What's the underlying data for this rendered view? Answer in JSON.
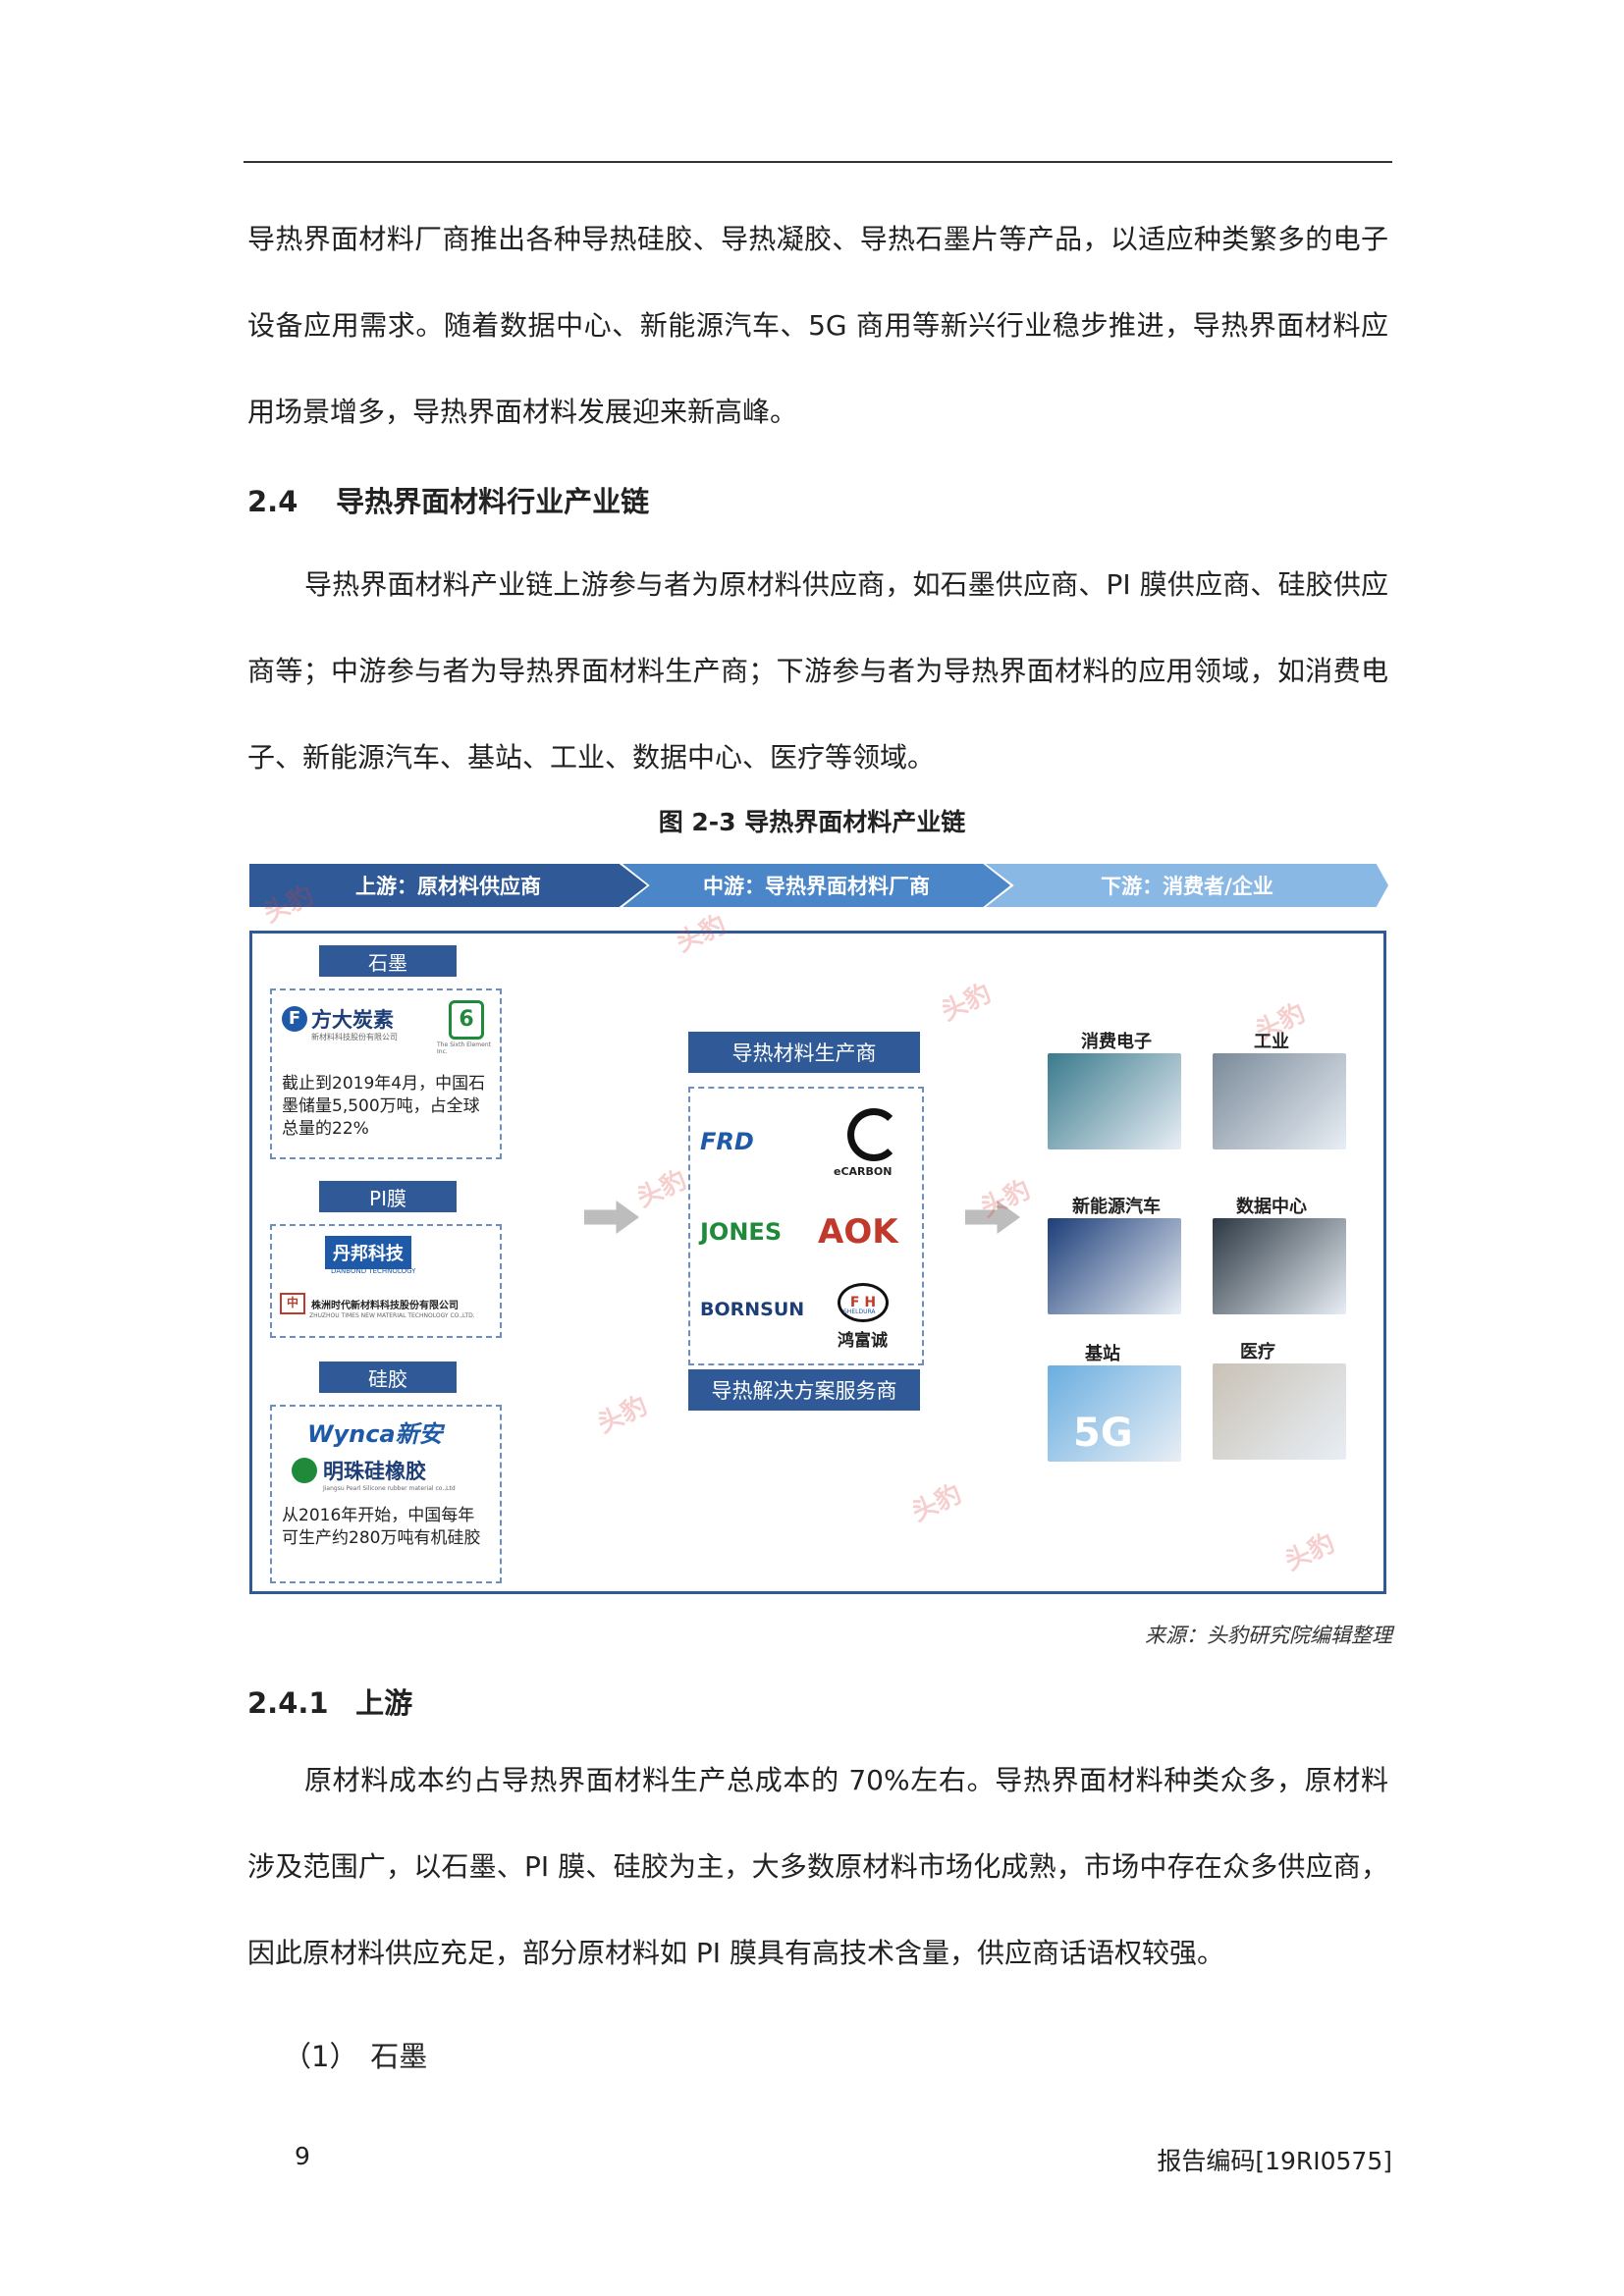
{
  "intro_paragraph": "导热界面材料厂商推出各种导热硅胶、导热凝胶、导热石墨片等产品，以适应种类繁多的电子设备应用需求。随着数据中心、新能源汽车、5G 商用等新兴行业稳步推进，导热界面材料应用场景增多，导热界面材料发展迎来新高峰。",
  "section_24": {
    "number": "2.4",
    "title": "导热界面材料行业产业链"
  },
  "section_24_paragraph": "导热界面材料产业链上游参与者为原材料供应商，如石墨供应商、PI 膜供应商、硅胶供应商等；中游参与者为导热界面材料生产商；下游参与者为导热界面材料的应用领域，如消费电子、新能源汽车、基站、工业、数据中心、医疗等领域。",
  "figure": {
    "caption": "图 2-3 导热界面材料产业链",
    "stages": [
      "上游：原材料供应商",
      "中游：导热界面材料厂商",
      "下游：消费者/企业"
    ],
    "upstream": {
      "graphite": {
        "tag": "石墨",
        "logo_1": "方大炭素",
        "logo_1_sub": "新材料科技股份有限公司",
        "logo_2": "6",
        "logo_2_sub": "The Sixth Element Inc.",
        "note": "截止到2019年4月，中国石墨储量5,500万吨，占全球总量的22%"
      },
      "pi_film": {
        "tag": "PI膜",
        "logo_1": "丹邦科技",
        "logo_1_sub": "DANBOND TECHNOLOGY",
        "logo_2": "株洲时代新材料科技股份有限公司",
        "logo_2_sub": "ZHUZHOU TIMES NEW MATERIAL TECHNOLOGY CO.,LTD."
      },
      "silicone": {
        "tag": "硅胶",
        "logo_1": "Wynca新安",
        "logo_2": "明珠硅橡胶",
        "logo_2_sub": "Jiangsu Pearl Silicone rubber material co.,Ltd",
        "note": "从2016年开始，中国每年可生产约280万吨有机硅胶"
      }
    },
    "midstream": {
      "tag_top": "导热材料生产商",
      "tag_bottom": "导热解决方案服务商",
      "logos": [
        "FRD",
        "eCARBON",
        "JONES",
        "AOK",
        "BORNSUN",
        "鸿富诚"
      ],
      "logo_fh_mark": "F H",
      "logo_fh_sub": "SHELDURA"
    },
    "downstream": [
      {
        "label": "消费电子",
        "color": "#3a7a8c"
      },
      {
        "label": "工业",
        "color": "#7a8a99"
      },
      {
        "label": "新能源汽车",
        "color": "#1c3d78"
      },
      {
        "label": "数据中心",
        "color": "#2b3742"
      },
      {
        "label": "基站",
        "color": "#6aaee0"
      },
      {
        "label": "医疗",
        "color": "#c9c2b6"
      }
    ],
    "img_text_5g": "5G",
    "watermark": "头豹"
  },
  "source": "来源：头豹研究院编辑整理",
  "section_241": {
    "number": "2.4.1",
    "title": "上游"
  },
  "section_241_paragraph": "原材料成本约占导热界面材料生产总成本的 70%左右。导热界面材料种类众多，原材料涉及范围广，以石墨、PI 膜、硅胶为主，大多数原材料市场化成熟，市场中存在众多供应商，因此原材料供应充足，部分原材料如 PI 膜具有高技术含量，供应商话语权较强。",
  "item_1": {
    "number": "（1）",
    "title": "石墨"
  },
  "footer": {
    "page_number": "9",
    "report_code": "报告编码[19RI0575]"
  }
}
